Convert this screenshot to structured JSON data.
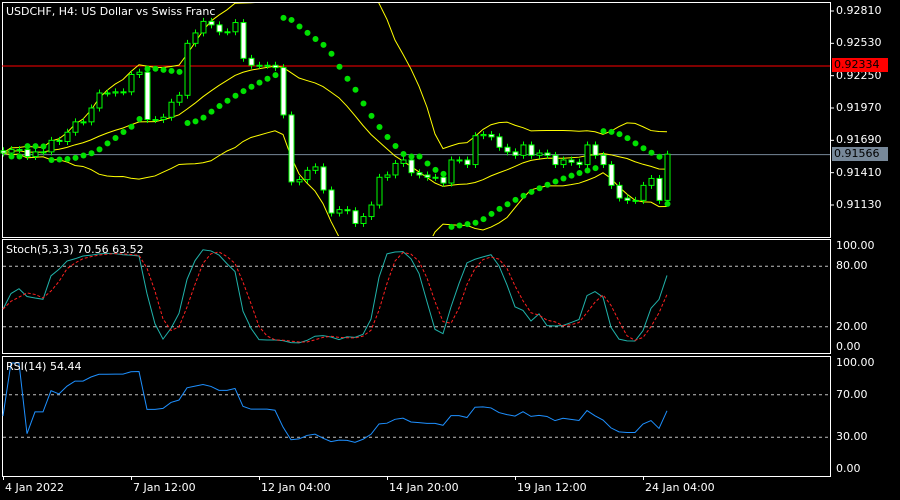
{
  "title": "USDCHF, H4:  US Dollar vs Swiss Franc",
  "colors": {
    "bg": "#000000",
    "frame": "#ffffff",
    "candle": "#00ff00",
    "bear_body": "#ffffff",
    "bands": "#ffff00",
    "sar": "#00e000",
    "stoch_main": "#20b2aa",
    "stoch_signal": "#ff2020",
    "rsi": "#1e90ff",
    "ask_line": "#ff0000",
    "bid_line": "#778899"
  },
  "ask": {
    "value": 0.92334,
    "label": "0.92334"
  },
  "bid": {
    "value": 0.91566,
    "label": "0.91566"
  },
  "price_axis": {
    "range": [
      0.9081,
      0.9285
    ],
    "ticks": [
      "0.92810",
      "0.92530",
      "0.92250",
      "0.91970",
      "0.91690",
      "0.91410",
      "0.91130"
    ]
  },
  "stoch": {
    "label": "Stoch(5,3,3) 70.56 63.52",
    "ticks": [
      "100.00",
      "80.00",
      "20.00",
      "0.00"
    ]
  },
  "rsi": {
    "label": "RSI(14) 54.44",
    "ticks": [
      "100.00",
      "70.00",
      "30.00",
      "0.00"
    ]
  },
  "time_axis": [
    {
      "label": "4 Jan 2022",
      "bar": 0
    },
    {
      "label": "7 Jan 12:00",
      "bar": 16
    },
    {
      "label": "12 Jan 04:00",
      "bar": 32
    },
    {
      "label": "14 Jan 20:00",
      "bar": 48
    },
    {
      "label": "19 Jan 12:00",
      "bar": 64
    },
    {
      "label": "24 Jan 04:00",
      "bar": 80
    }
  ],
  "chart_data": {
    "type": "candlestick",
    "symbol": "USDCHF",
    "timeframe": "H4",
    "closes": [
      0.9158,
      0.9161,
      0.9161,
      0.9155,
      0.9159,
      0.9159,
      0.9169,
      0.9168,
      0.9176,
      0.9185,
      0.9185,
      0.9197,
      0.921,
      0.921,
      0.9211,
      0.9211,
      0.9226,
      0.9228,
      0.9187,
      0.9187,
      0.9189,
      0.9202,
      0.9208,
      0.9253,
      0.9262,
      0.9272,
      0.9269,
      0.9263,
      0.9263,
      0.9271,
      0.924,
      0.9234,
      0.9234,
      0.9234,
      0.9232,
      0.9191,
      0.9133,
      0.9135,
      0.9143,
      0.9146,
      0.9126,
      0.9106,
      0.9109,
      0.9108,
      0.9097,
      0.9103,
      0.9113,
      0.9137,
      0.9139,
      0.9149,
      0.9152,
      0.9141,
      0.9139,
      0.9137,
      0.9137,
      0.9132,
      0.9152,
      0.9152,
      0.9148,
      0.9173,
      0.9174,
      0.9172,
      0.9163,
      0.9159,
      0.9156,
      0.9165,
      0.9156,
      0.9158,
      0.9156,
      0.9148,
      0.9152,
      0.915,
      0.9148,
      0.9165,
      0.9156,
      0.9148,
      0.913,
      0.9119,
      0.9117,
      0.9117,
      0.913,
      0.9136,
      0.9117,
      0.9157
    ],
    "indicators": [
      "Bollinger Bands(20,2)",
      "Parabolic SAR(0.02,0.2)",
      "Stochastic(5,3,3)",
      "RSI(14)"
    ],
    "stoch_levels": [
      80,
      20
    ],
    "rsi_levels": [
      70,
      30
    ]
  }
}
